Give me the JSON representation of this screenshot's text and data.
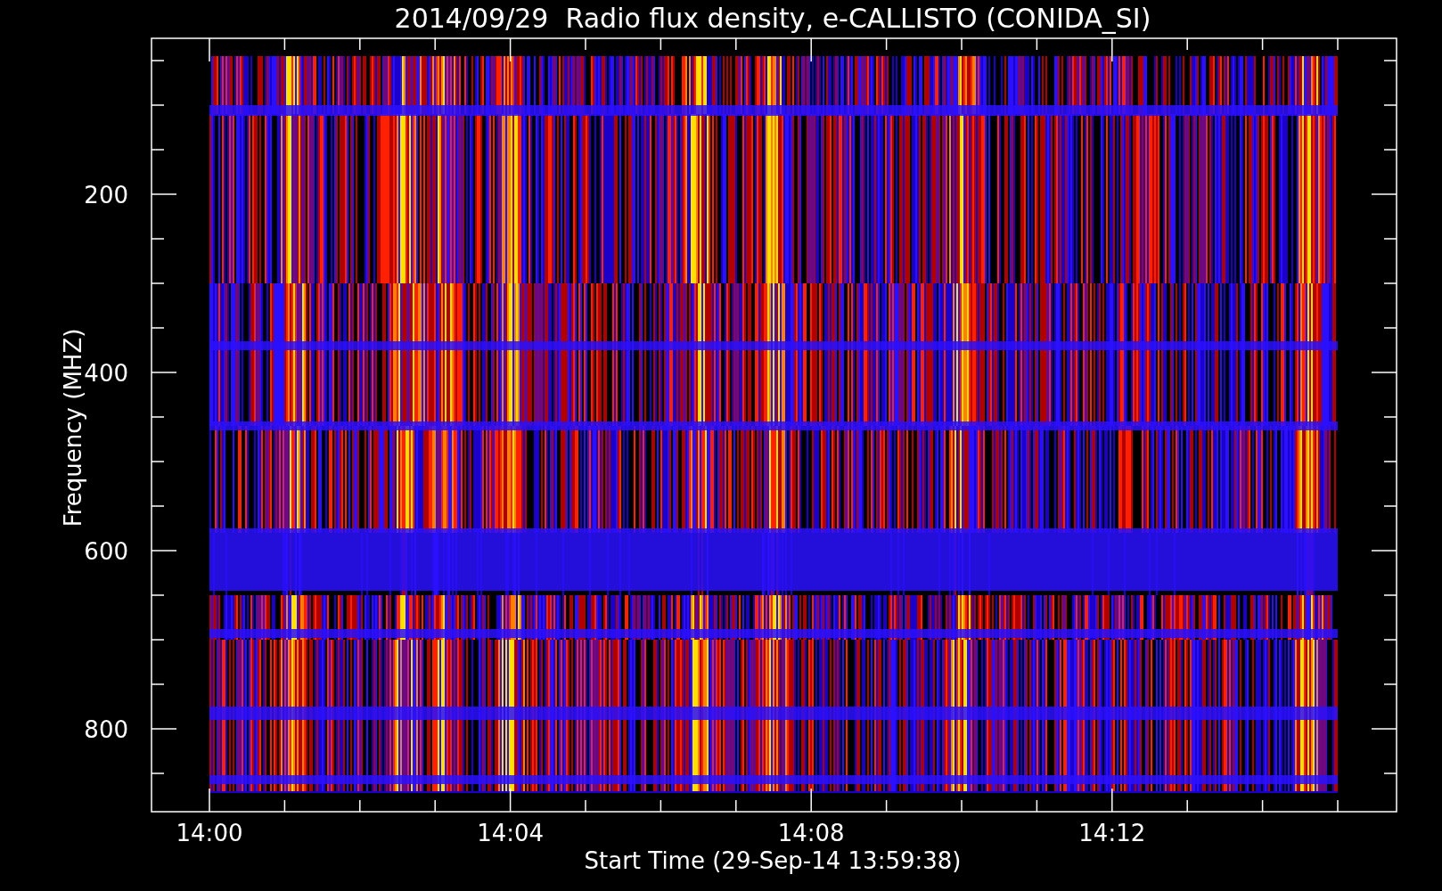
{
  "plot": {
    "title": "2014/09/29  Radio flux density, e-CALLISTO (CONIDA_SI)",
    "xlabel": "Start Time (29-Sep-14 13:59:38)",
    "ylabel": "Frequency (MHZ)",
    "x_ticks": [
      "14:00",
      "14:04",
      "14:08",
      "14:12"
    ],
    "y_ticks": [
      "200",
      "400",
      "600",
      "800"
    ]
  }
}
